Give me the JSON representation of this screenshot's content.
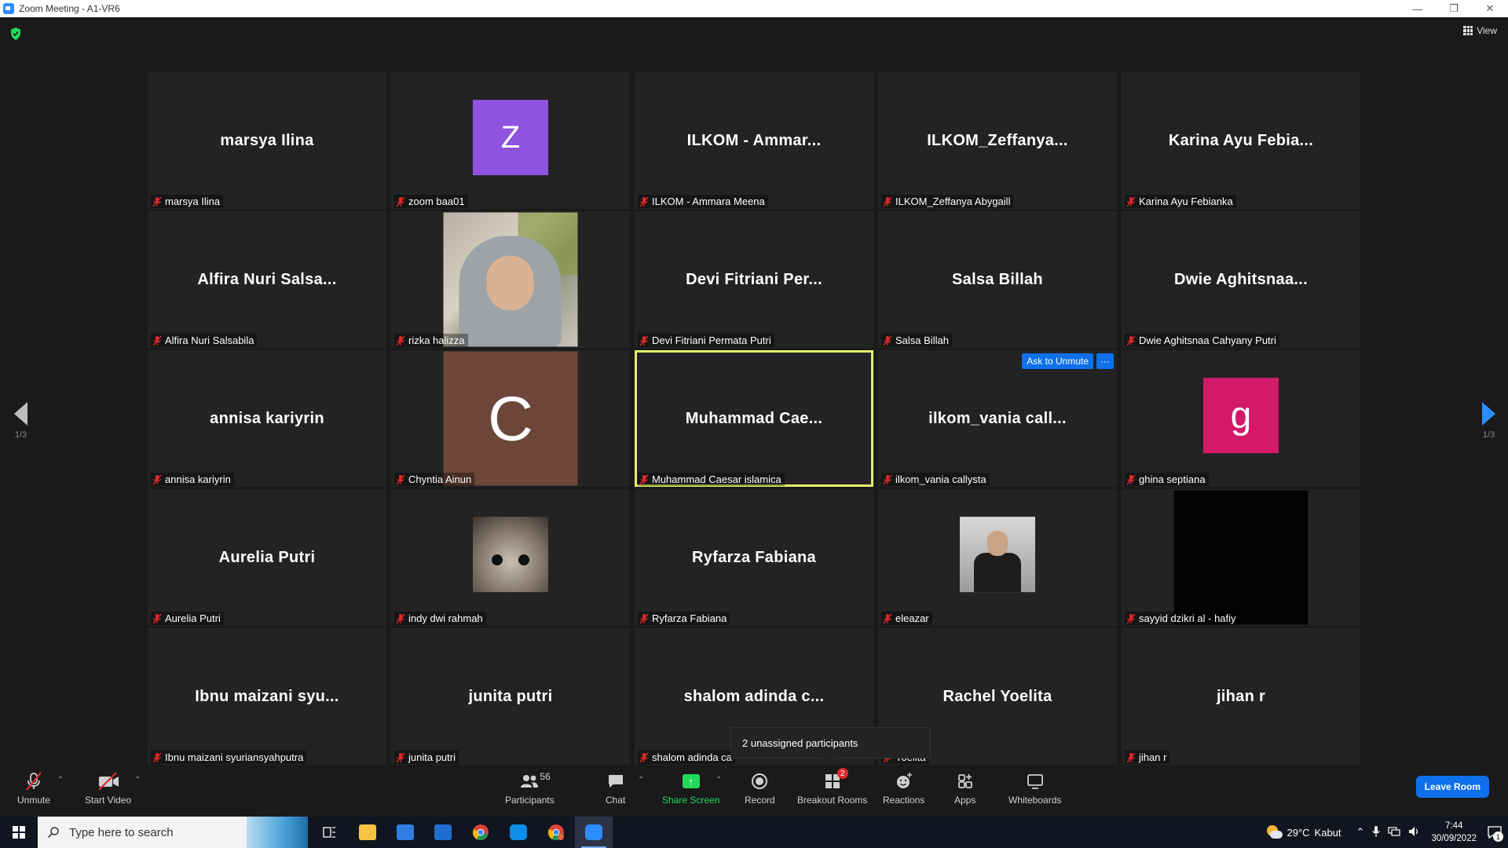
{
  "window": {
    "title": "Zoom Meeting - A1-VR6",
    "icon": "zoom-app-icon"
  },
  "top": {
    "view_label": "View",
    "shield_icon": "security-shield-icon"
  },
  "pager": {
    "left_label": "1/3",
    "right_label": "1/3"
  },
  "tiles": [
    {
      "display": "marsya Ilina",
      "name": "marsya Ilina",
      "kind": "name"
    },
    {
      "display": "Z",
      "name": "zoom baa01",
      "kind": "avatar-z"
    },
    {
      "display": "ILKOM - Ammar...",
      "name": "ILKOM - Ammara Meena",
      "kind": "name"
    },
    {
      "display": "ILKOM_Zeffanya...",
      "name": "ILKOM_Zeffanya Abygaill",
      "kind": "name"
    },
    {
      "display": "Karina Ayu Febia...",
      "name": "Karina Ayu Febianka",
      "kind": "name"
    },
    {
      "display": "Alfira Nuri Salsa...",
      "name": "Alfira Nuri Salsabila",
      "kind": "name"
    },
    {
      "display": "",
      "name": "rizka halizza",
      "kind": "photo-hoodie"
    },
    {
      "display": "Devi Fitriani Per...",
      "name": "Devi Fitriani Permata Putri",
      "kind": "name"
    },
    {
      "display": "Salsa Billah",
      "name": "Salsa Billah",
      "kind": "name"
    },
    {
      "display": "Dwie Aghitsnaa...",
      "name": "Dwie Aghitsnaa Cahyany Putri",
      "kind": "name"
    },
    {
      "display": "annisa kariyrin",
      "name": "annisa kariyrin",
      "kind": "name"
    },
    {
      "display": "C",
      "name": "Chyntia Ainun",
      "kind": "avatar-c"
    },
    {
      "display": "Muhammad Cae...",
      "name": "Muhammad Caesar islamica",
      "kind": "name",
      "active": true
    },
    {
      "display": "ilkom_vania call...",
      "name": "ilkom_vania callysta",
      "kind": "name",
      "hover": true
    },
    {
      "display": "g",
      "name": "ghina septiana",
      "kind": "avatar-g"
    },
    {
      "display": "Aurelia Putri",
      "name": "Aurelia Putri",
      "kind": "name"
    },
    {
      "display": "",
      "name": "indy dwi rahmah",
      "kind": "photo-cat"
    },
    {
      "display": "Ryfarza Fabiana",
      "name": "Ryfarza Fabiana",
      "kind": "name"
    },
    {
      "display": "",
      "name": "eleazar",
      "kind": "photo-man"
    },
    {
      "display": "",
      "name": "sayyid dzikri al - hafiy",
      "kind": "photo-black"
    },
    {
      "display": "Ibnu maizani syu...",
      "name": "Ibnu maizani syuriansyahputra",
      "kind": "name"
    },
    {
      "display": "junita putri",
      "name": "junita putri",
      "kind": "name"
    },
    {
      "display": "shalom adinda c...",
      "name": "shalom adinda ca",
      "kind": "name"
    },
    {
      "display": "Rachel Yoelita",
      "name": "Yoelita",
      "kind": "name"
    },
    {
      "display": "jihan r",
      "name": "jihan r",
      "kind": "name"
    }
  ],
  "hover": {
    "ask_unmute": "Ask to Unmute",
    "more": "···"
  },
  "tooltip": {
    "text": "2 unassigned participants"
  },
  "toolbar": {
    "unmute": "Unmute",
    "start_video": "Start Video",
    "participants": "Participants",
    "participants_count": "56",
    "chat": "Chat",
    "share_screen": "Share Screen",
    "record": "Record",
    "breakout_rooms": "Breakout Rooms",
    "breakout_badge": "2",
    "reactions": "Reactions",
    "apps": "Apps",
    "whiteboards": "Whiteboards",
    "leave": "Leave Room",
    "share_color": "#23d959",
    "leave_color": "#0e71eb"
  },
  "taskbar": {
    "search_placeholder": "Type here to search",
    "weather_temp": "29°C",
    "weather_desc": "Kabut",
    "time": "7:44",
    "date": "30/09/2022",
    "notif_count": "1"
  }
}
